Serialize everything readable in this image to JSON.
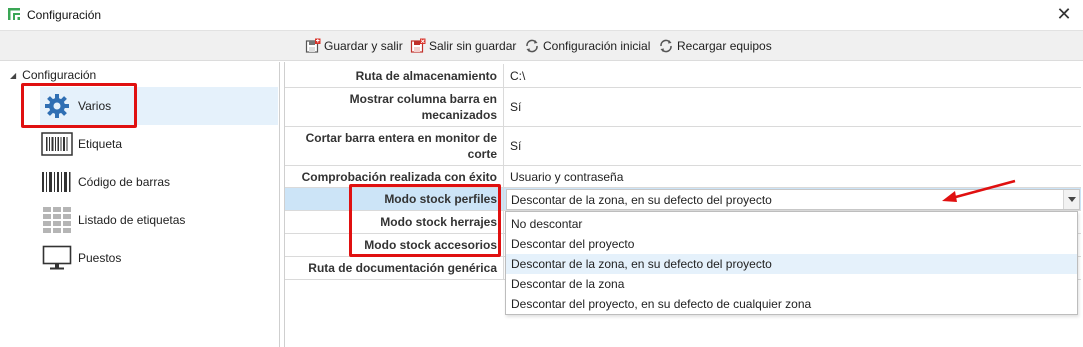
{
  "window": {
    "title": "Configuración",
    "close_glyph": "✕"
  },
  "toolbar": {
    "save_exit": "Guardar y salir",
    "exit_no_save": "Salir sin guardar",
    "initial_config": "Configuración inicial",
    "reload_equipment": "Recargar equipos"
  },
  "tree": {
    "root": "Configuración",
    "items": [
      {
        "label": "Varios",
        "icon": "gear-icon"
      },
      {
        "label": "Etiqueta",
        "icon": "label-icon"
      },
      {
        "label": "Código de barras",
        "icon": "barcode-icon"
      },
      {
        "label": "Listado de etiquetas",
        "icon": "label-list-icon"
      },
      {
        "label": "Puestos",
        "icon": "monitor-icon"
      }
    ]
  },
  "properties": [
    {
      "key": "Ruta de almacenamiento",
      "value": "C:\\"
    },
    {
      "key": "Mostrar columna barra en mecanizados",
      "value": "Sí"
    },
    {
      "key": "Cortar barra entera en monitor de corte",
      "value": "Sí"
    },
    {
      "key": "Comprobación realizada con éxito",
      "value": "Usuario y contraseña"
    },
    {
      "key": "Modo stock perfiles",
      "value": "Descontar de la zona, en su defecto del proyecto"
    },
    {
      "key": "Modo stock herrajes",
      "value": ""
    },
    {
      "key": "Modo stock accesorios",
      "value": ""
    },
    {
      "key": "Ruta de documentación genérica",
      "value": ""
    }
  ],
  "dropdown": {
    "options": [
      "No descontar",
      "Descontar del proyecto",
      "Descontar de la zona, en su defecto del proyecto",
      "Descontar de la zona",
      "Descontar del proyecto, en su defecto de cualquier zona"
    ],
    "highlighted_index": 2
  },
  "colors": {
    "annotation_red": "#e01010",
    "selection_blue": "#cce4f7",
    "hover_blue": "#e5f1fb"
  }
}
